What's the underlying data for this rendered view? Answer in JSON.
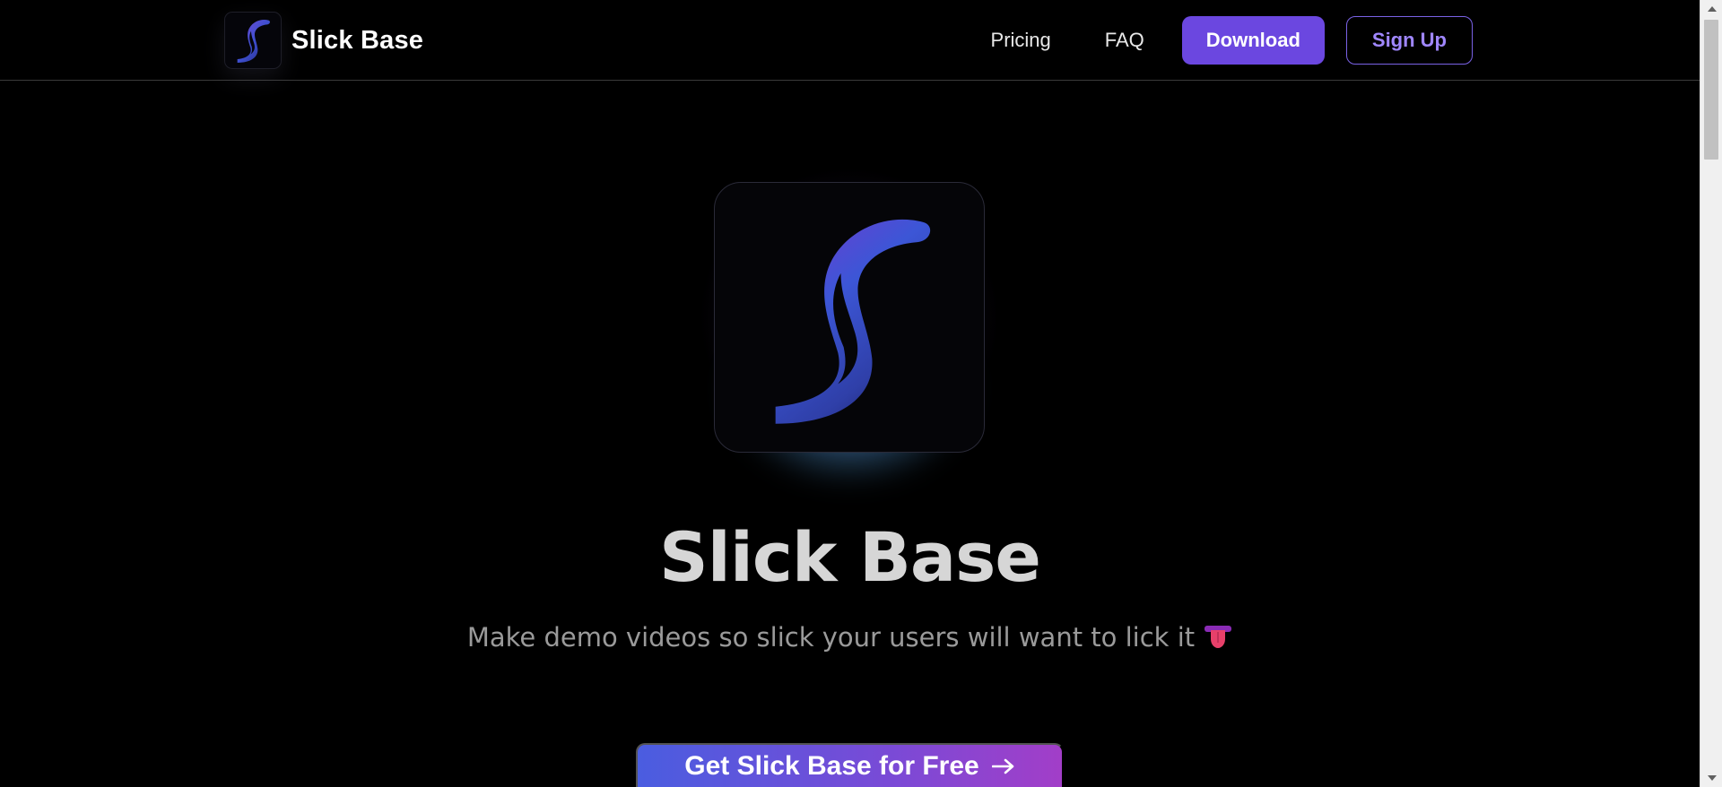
{
  "header": {
    "brand_name": "Slick Base",
    "nav": {
      "pricing": "Pricing",
      "faq": "FAQ",
      "download": "Download",
      "signup": "Sign Up"
    }
  },
  "hero": {
    "title": "Slick Base",
    "subtitle": "Make demo videos so slick your users will want to lick it",
    "cta_label": "Get Slick Base for Free",
    "cta_icon": "arrow-right-icon",
    "logo_icon": "slick-base-s-logo-icon",
    "emoji_icon": "tongue-emoji-icon"
  },
  "colors": {
    "accent": "#6b47e0",
    "accent_light": "#a087ff",
    "background": "#000000",
    "cta_start": "#4a5de0",
    "cta_end": "#a23ec8"
  }
}
